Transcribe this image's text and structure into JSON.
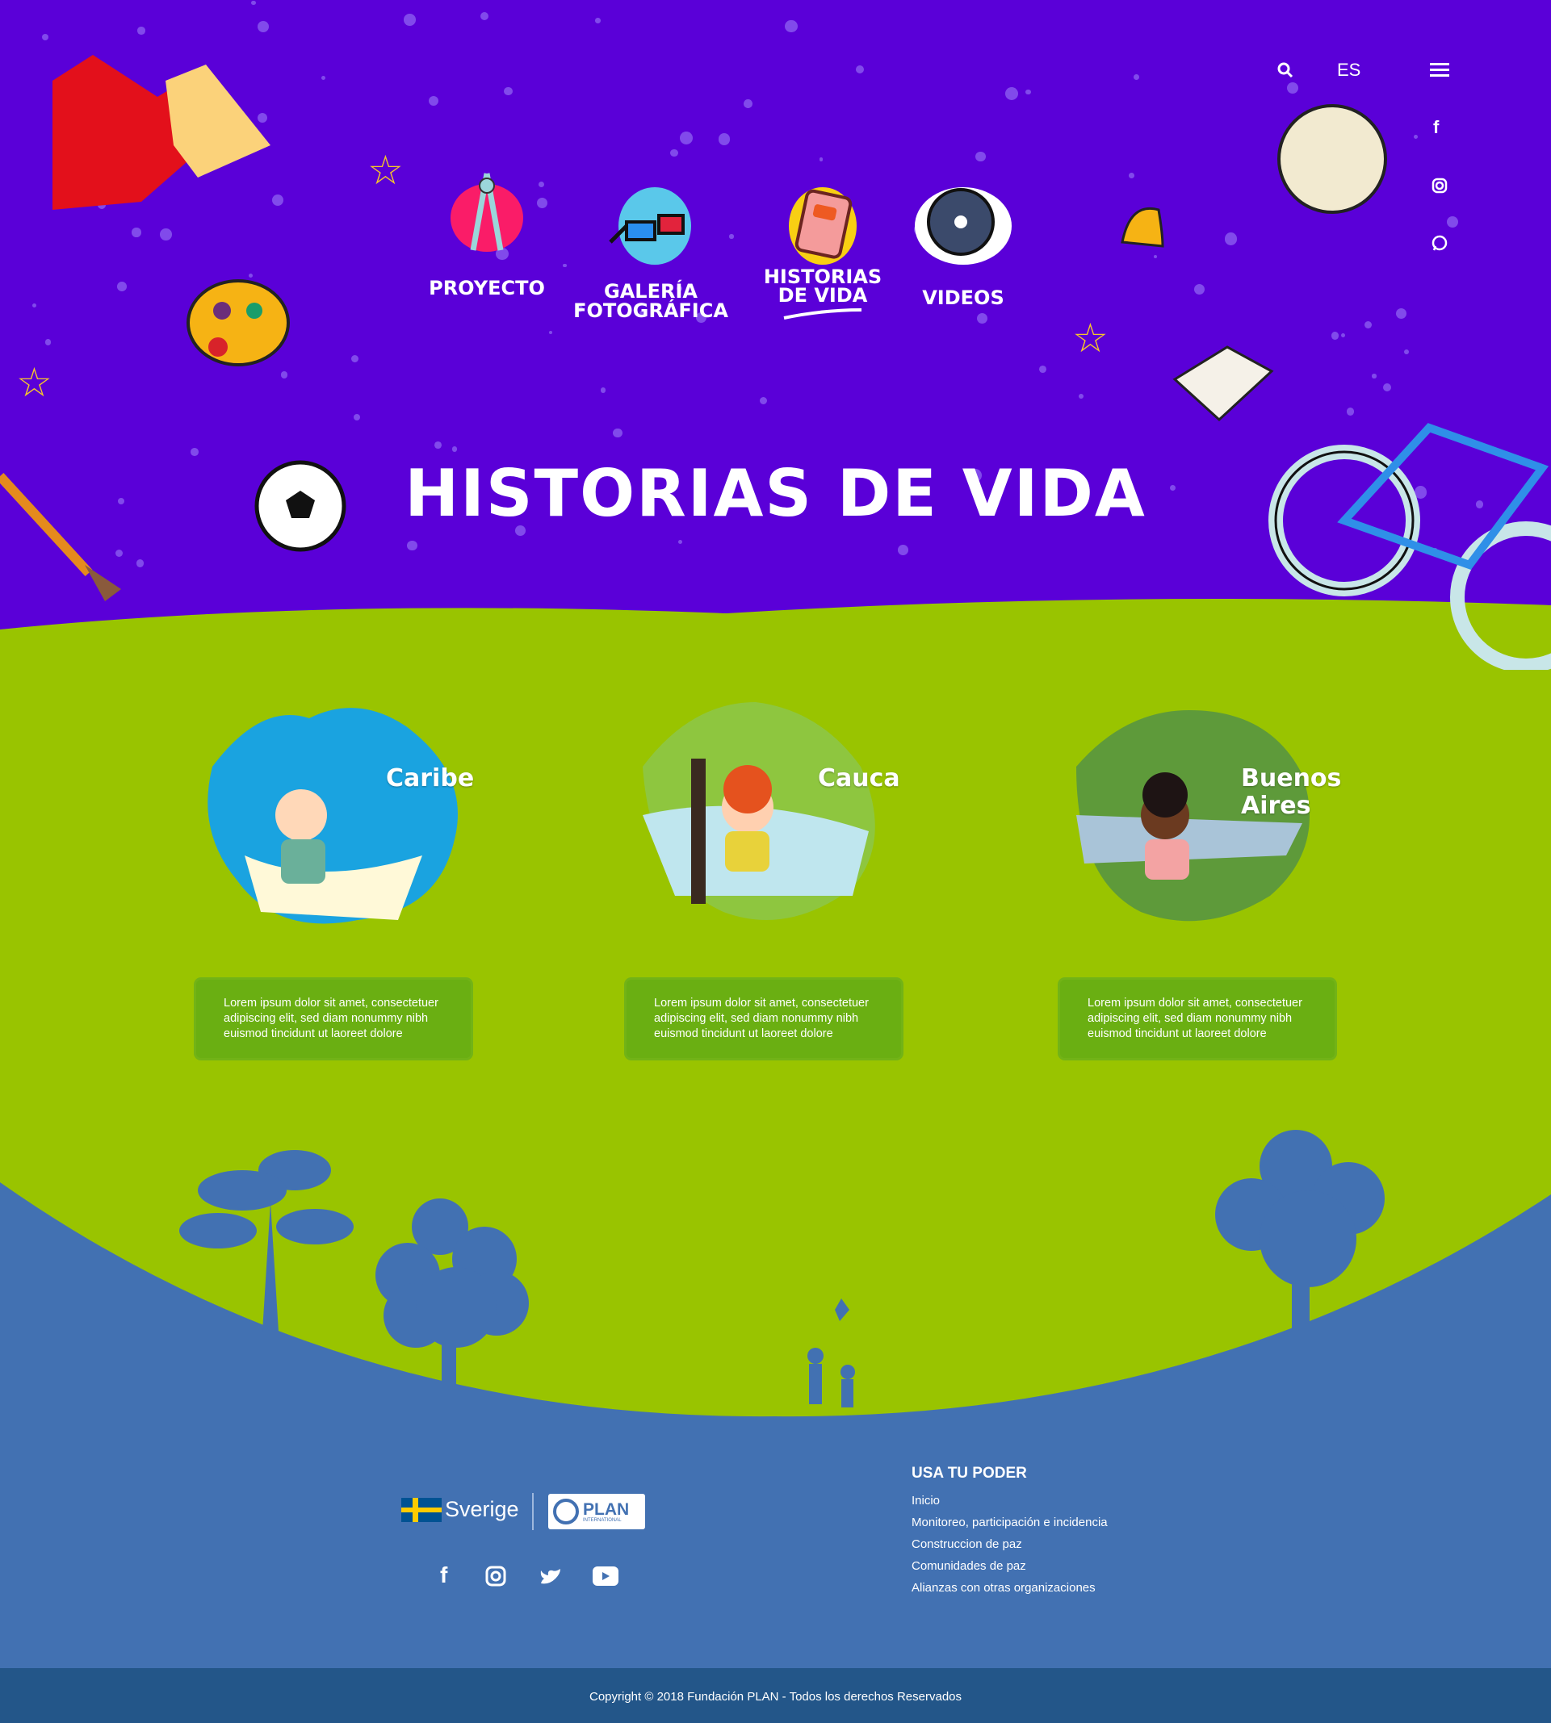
{
  "header": {
    "language": "ES",
    "icons": [
      "search-icon",
      "menu-icon"
    ],
    "social": [
      "facebook-icon",
      "instagram-icon",
      "whatsapp-icon"
    ]
  },
  "nav": [
    {
      "label": "PROYECTO",
      "icon": "compass-icon"
    },
    {
      "label": "GALERÍA FOTOGRÁFICA",
      "icon": "glasses-icon"
    },
    {
      "label": "HISTORIAS DE VIDA",
      "icon": "book-icon",
      "active": true
    },
    {
      "label": "VIDEOS",
      "icon": "film-reel-icon"
    }
  ],
  "page_title": "HISTORIAS DE VIDA",
  "stories": [
    {
      "name": "Caribe",
      "text": "Lorem ipsum dolor sit amet, consectetuer adipiscing elit, sed diam nonummy nibh euismod tincidunt ut laoreet dolore"
    },
    {
      "name": "Cauca",
      "text": "Lorem ipsum dolor sit amet, consectetuer adipiscing elit, sed diam nonummy nibh euismod tincidunt ut laoreet dolore"
    },
    {
      "name": "Buenos Aires",
      "text": "Lorem ipsum dolor sit amet, consectetuer adipiscing elit, sed diam nonummy nibh euismod tincidunt ut laoreet dolore"
    }
  ],
  "footer": {
    "logos": {
      "sverige": "Sverige",
      "plan": "PLAN",
      "plan_sub": "INTERNATIONAL"
    },
    "social": [
      "facebook-icon",
      "instagram-icon",
      "twitter-icon",
      "youtube-icon"
    ],
    "heading": "USA TU PODER",
    "links": [
      "Inicio",
      "Monitoreo, participación e incidencia",
      "Construccion de paz",
      "Comunidades de paz",
      "Alianzas con otras organizaciones"
    ],
    "copyright": "Copyright © 2018 Fundación PLAN - Todos los derechos Reservados"
  },
  "colors": {
    "sky": "#5a00d8",
    "grass": "#99c400",
    "ground": "#4271b2",
    "bar": "#235689"
  }
}
